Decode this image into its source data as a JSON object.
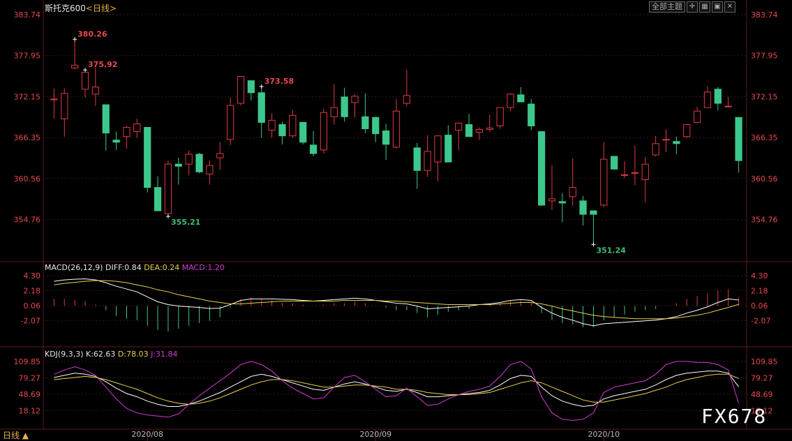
{
  "header": {
    "symbol": "斯托克600",
    "period": "<日线>",
    "theme_button": "全部主题"
  },
  "colors": {
    "up": "#e03a44",
    "down": "#3cc88c",
    "grid": "#3a1414",
    "axis_text_red": "#e84850",
    "axis_text_green": "#3fbf78",
    "diff": "#ffffff",
    "dea": "#e8d24a",
    "j": "#d23bd2"
  },
  "chart_data": [
    {
      "type": "candlestick",
      "yticks": [
        383.74,
        377.95,
        372.15,
        366.35,
        360.56,
        354.76
      ],
      "x_dates": [
        "2020/08",
        "2020/09",
        "2020/10"
      ],
      "annotations": [
        "380.26",
        "375.92",
        "355.21",
        "351.24",
        "373.58"
      ],
      "ohlc": [
        [
          371.8,
          373.3,
          369.0,
          371.8
        ],
        [
          369.0,
          373.3,
          366.5,
          372.6
        ],
        [
          376.2,
          380.3,
          376.0,
          376.6
        ],
        [
          373.2,
          375.9,
          372.0,
          375.6
        ],
        [
          372.5,
          376.3,
          370.8,
          373.5
        ],
        [
          371.0,
          371.0,
          364.5,
          367.0
        ],
        [
          366.0,
          367.2,
          364.6,
          365.7
        ],
        [
          366.5,
          368.0,
          364.8,
          367.8
        ],
        [
          367.2,
          369.0,
          366.3,
          368.3
        ],
        [
          367.8,
          367.8,
          358.6,
          359.3
        ],
        [
          359.3,
          360.9,
          356.0,
          356.0
        ],
        [
          355.6,
          363.1,
          355.2,
          362.6
        ],
        [
          362.6,
          363.5,
          359.7,
          362.3
        ],
        [
          362.6,
          364.5,
          361.0,
          364.0
        ],
        [
          364.0,
          364.2,
          361.3,
          361.5
        ],
        [
          361.2,
          363.1,
          359.7,
          362.4
        ],
        [
          363.5,
          365.7,
          361.8,
          364.1
        ],
        [
          366.1,
          372.0,
          365.3,
          370.9
        ],
        [
          371.2,
          375.0,
          370.9,
          375.0
        ],
        [
          374.4,
          374.4,
          371.6,
          372.7
        ],
        [
          372.7,
          373.6,
          366.3,
          368.5
        ],
        [
          367.4,
          369.8,
          366.3,
          368.8
        ],
        [
          368.2,
          368.6,
          365.4,
          366.6
        ],
        [
          366.6,
          370.3,
          366.3,
          369.5
        ],
        [
          368.5,
          368.6,
          365.4,
          365.7
        ],
        [
          365.3,
          367.3,
          363.7,
          364.1
        ],
        [
          364.6,
          370.4,
          364.1,
          369.9
        ],
        [
          369.3,
          373.9,
          368.2,
          370.6
        ],
        [
          372.1,
          373.4,
          368.6,
          369.3
        ],
        [
          371.3,
          372.5,
          369.2,
          372.2
        ],
        [
          369.3,
          372.6,
          367.0,
          367.6
        ],
        [
          369.2,
          369.3,
          365.7,
          366.9
        ],
        [
          367.3,
          368.3,
          363.2,
          365.4
        ],
        [
          365.0,
          371.8,
          364.8,
          370.1
        ],
        [
          371.2,
          375.9,
          370.8,
          372.3
        ],
        [
          364.9,
          365.6,
          359.1,
          361.7
        ],
        [
          361.7,
          366.7,
          360.8,
          364.4
        ],
        [
          362.9,
          366.6,
          360.2,
          366.6
        ],
        [
          366.7,
          368.1,
          362.9,
          362.9
        ],
        [
          367.4,
          368.5,
          364.6,
          368.4
        ],
        [
          368.2,
          369.7,
          366.5,
          366.5
        ],
        [
          367.1,
          367.8,
          366.0,
          367.5
        ],
        [
          367.5,
          369.6,
          367.2,
          367.7
        ],
        [
          368.0,
          370.6,
          367.6,
          370.6
        ],
        [
          370.6,
          372.6,
          370.1,
          372.5
        ],
        [
          372.4,
          373.5,
          371.4,
          371.4
        ],
        [
          371.1,
          371.8,
          367.4,
          368.0
        ],
        [
          367.2,
          367.2,
          356.7,
          356.8
        ],
        [
          357.4,
          362.5,
          356.1,
          357.7
        ],
        [
          357.3,
          358.5,
          354.4,
          357.1
        ],
        [
          358.0,
          363.4,
          356.7,
          359.3
        ],
        [
          357.4,
          358.1,
          353.9,
          355.5
        ],
        [
          356.0,
          356.0,
          351.2,
          355.5
        ],
        [
          356.8,
          365.7,
          356.5,
          363.3
        ],
        [
          363.7,
          363.7,
          361.8,
          361.9
        ],
        [
          361.0,
          363.0,
          360.6,
          361.1
        ],
        [
          361.3,
          365.2,
          359.6,
          361.4
        ],
        [
          360.4,
          363.6,
          357.2,
          362.6
        ],
        [
          363.9,
          366.6,
          363.7,
          365.5
        ],
        [
          366.0,
          367.5,
          364.3,
          366.1
        ],
        [
          365.8,
          366.5,
          364.0,
          365.5
        ],
        [
          366.5,
          368.1,
          366.3,
          368.2
        ],
        [
          368.5,
          370.7,
          368.5,
          370.1
        ],
        [
          370.6,
          373.6,
          370.6,
          372.8
        ],
        [
          373.2,
          373.5,
          370.2,
          371.2
        ],
        [
          370.8,
          372.1,
          370.6,
          370.8
        ],
        [
          369.2,
          369.2,
          361.4,
          363.1
        ]
      ]
    },
    {
      "type": "macd",
      "params": "MACD(26,12,9)",
      "diff_label": "DIFF:0.84",
      "dea_label": "DEA:0.24",
      "macd_label": "MACD:1.20",
      "yticks": [
        4.3,
        2.18,
        0.06,
        -2.07
      ],
      "diff": [
        3.5,
        3.7,
        3.8,
        3.85,
        3.7,
        3.3,
        2.8,
        2.4,
        2.0,
        1.3,
        0.6,
        0.2,
        0.0,
        -0.1,
        -0.2,
        -0.35,
        -0.3,
        0.2,
        0.8,
        1.0,
        1.0,
        1.0,
        0.95,
        0.9,
        0.8,
        0.7,
        0.8,
        0.9,
        1.0,
        1.1,
        1.0,
        0.8,
        0.6,
        0.4,
        0.3,
        0.0,
        -0.4,
        -0.3,
        -0.2,
        -0.1,
        0.0,
        0.2,
        0.3,
        0.5,
        0.8,
        0.9,
        0.8,
        -0.2,
        -1.0,
        -1.6,
        -2.0,
        -2.5,
        -2.8,
        -2.5,
        -2.4,
        -2.3,
        -2.2,
        -2.1,
        -2.0,
        -1.8,
        -1.5,
        -1.0,
        -0.6,
        -0.1,
        0.5,
        1.0,
        0.84
      ],
      "dea": [
        3.0,
        3.2,
        3.35,
        3.5,
        3.6,
        3.6,
        3.5,
        3.3,
        3.0,
        2.7,
        2.3,
        2.0,
        1.6,
        1.3,
        1.0,
        0.7,
        0.5,
        0.3,
        0.3,
        0.4,
        0.5,
        0.6,
        0.7,
        0.7,
        0.7,
        0.7,
        0.7,
        0.7,
        0.8,
        0.8,
        0.8,
        0.8,
        0.7,
        0.7,
        0.6,
        0.5,
        0.4,
        0.3,
        0.2,
        0.2,
        0.2,
        0.2,
        0.2,
        0.3,
        0.4,
        0.5,
        0.5,
        0.3,
        0.0,
        -0.4,
        -0.7,
        -1.0,
        -1.3,
        -1.5,
        -1.6,
        -1.7,
        -1.8,
        -1.8,
        -1.8,
        -1.8,
        -1.7,
        -1.5,
        -1.3,
        -1.0,
        -0.6,
        -0.2,
        0.24
      ],
      "macd": [
        1.0,
        1.0,
        0.9,
        0.7,
        0.2,
        -0.6,
        -1.4,
        -1.8,
        -2.0,
        -2.8,
        -3.4,
        -3.6,
        -3.2,
        -2.8,
        -2.4,
        -2.1,
        -1.6,
        -0.2,
        1.0,
        1.2,
        1.0,
        0.8,
        0.5,
        0.4,
        0.2,
        0.0,
        0.2,
        0.4,
        0.4,
        0.6,
        0.4,
        0.0,
        -0.2,
        -0.6,
        -0.6,
        -1.0,
        -1.6,
        -1.2,
        -0.8,
        -0.6,
        -0.4,
        0.0,
        0.2,
        0.4,
        0.8,
        0.8,
        0.6,
        -1.0,
        -2.0,
        -2.4,
        -2.6,
        -3.0,
        -3.0,
        -2.0,
        -1.6,
        -1.2,
        -0.8,
        -0.6,
        -0.4,
        0.0,
        0.4,
        1.0,
        1.4,
        1.8,
        2.2,
        2.4,
        1.2
      ]
    },
    {
      "type": "kdj",
      "params": "KDJ(9,3,3)",
      "k_label": "K:62.63",
      "d_label": "D:78.03",
      "j_label": "J:31.84",
      "yticks": [
        109.85,
        79.27,
        48.69,
        18.12
      ],
      "k": [
        80,
        84,
        88,
        86,
        82,
        72,
        60,
        50,
        44,
        36,
        30,
        26,
        26,
        30,
        36,
        44,
        52,
        62,
        72,
        82,
        86,
        82,
        76,
        70,
        64,
        58,
        56,
        62,
        68,
        72,
        68,
        62,
        56,
        54,
        58,
        52,
        44,
        44,
        46,
        48,
        50,
        52,
        56,
        66,
        78,
        84,
        82,
        62,
        46,
        36,
        30,
        26,
        28,
        40,
        46,
        50,
        54,
        58,
        66,
        76,
        84,
        88,
        90,
        92,
        92,
        88,
        62.63
      ],
      "d": [
        76,
        78,
        80,
        82,
        80,
        76,
        70,
        64,
        58,
        50,
        42,
        36,
        32,
        30,
        32,
        36,
        42,
        50,
        58,
        66,
        72,
        76,
        76,
        74,
        70,
        66,
        62,
        62,
        64,
        66,
        66,
        64,
        62,
        58,
        58,
        56,
        52,
        50,
        48,
        48,
        48,
        50,
        52,
        58,
        64,
        70,
        74,
        70,
        62,
        54,
        46,
        38,
        34,
        34,
        38,
        42,
        46,
        50,
        56,
        62,
        70,
        76,
        80,
        84,
        86,
        86,
        78.03
      ],
      "j": [
        86,
        94,
        100,
        94,
        84,
        62,
        40,
        22,
        14,
        10,
        8,
        6,
        12,
        30,
        46,
        60,
        74,
        88,
        104,
        110,
        104,
        92,
        74,
        60,
        50,
        40,
        42,
        62,
        80,
        84,
        72,
        58,
        44,
        46,
        60,
        44,
        28,
        30,
        40,
        48,
        54,
        58,
        64,
        82,
        104,
        110,
        96,
        44,
        14,
        2,
        0,
        2,
        14,
        52,
        62,
        66,
        70,
        74,
        86,
        104,
        110,
        110,
        108,
        108,
        104,
        94,
        31.84
      ]
    }
  ],
  "footer": {
    "period_switch": "日线 ▲",
    "watermark": "FX678"
  }
}
